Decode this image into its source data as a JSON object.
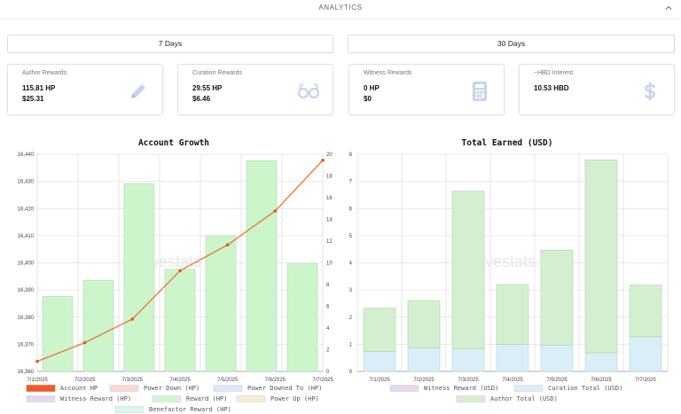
{
  "header": {
    "title": "ANALYTICS",
    "collapse_icon": "chevron-up-icon"
  },
  "periods": [
    {
      "label": "7 Days"
    },
    {
      "label": "30 Days"
    }
  ],
  "cards": [
    {
      "label": "Author Rewards",
      "value1": "115.81 HP",
      "value2": "$25.31",
      "icon": "pencil-icon"
    },
    {
      "label": "Curation Rewards",
      "value1": "29.55 HP",
      "value2": "$6.46",
      "icon": "glasses-icon"
    },
    {
      "label": "Witness Rewards",
      "value1": "0 HP",
      "value2": "$0",
      "icon": "calculator-icon"
    },
    {
      "label": "~HBD Interest",
      "value1": "10.53 HBD",
      "value2": "",
      "icon": "dollar-icon"
    }
  ],
  "colors": {
    "line": "#ee7a3e",
    "reward_bar": "#ccf5cc",
    "author_bar": "#d4efd0",
    "curation_bar": "#daeef8",
    "icon": "#c9d3ec"
  },
  "watermark": "hivestats.io",
  "chart_data": [
    {
      "type": "bar",
      "title": "Account Growth",
      "categories": [
        "7/1/2025",
        "7/2/2025",
        "7/3/2025",
        "7/4/2025",
        "7/5/2025",
        "7/6/2025",
        "7/7/2025"
      ],
      "left_axis": {
        "ylim": [
          16360,
          16440
        ],
        "ticks": [
          "16,360",
          "16,370",
          "16,380",
          "16,390",
          "16,400",
          "16,410",
          "16,420",
          "16,430",
          "16,440"
        ]
      },
      "right_axis": {
        "ylim": [
          0,
          20
        ],
        "ticks": [
          "0",
          "2",
          "4",
          "6",
          "8",
          "10",
          "12",
          "14",
          "16",
          "18",
          "20"
        ]
      },
      "series": [
        {
          "name": "Account HP",
          "kind": "line",
          "axis": "left",
          "values": [
            16363.7,
            16370.6,
            16379.3,
            16397.1,
            16406.6,
            16419.1,
            16437.8
          ]
        },
        {
          "name": "Reward (HP)",
          "kind": "bar",
          "axis": "right",
          "values": [
            6.9,
            8.4,
            17.3,
            9.4,
            12.5,
            19.4,
            9.9
          ]
        }
      ],
      "legend": [
        "Account HP",
        "Power Down (HP)",
        "Power Downed To (HP)",
        "Witness Reward (HP)",
        "Reward (HP)",
        "Power Up (HP)",
        "Benefactor Reward (HP)"
      ],
      "legend_colors": [
        "#f05a28",
        "#ffd6d6",
        "#dbe6fb",
        "#e6d8ee",
        "#d3f5d3",
        "#f8ecd0",
        "#dff5ec"
      ],
      "legend_placement": "bottom",
      "grid": true
    },
    {
      "type": "bar",
      "title": "Total Earned (USD)",
      "categories": [
        "7/1/2025",
        "7/2/2025",
        "7/3/2025",
        "7/4/2025",
        "7/5/2025",
        "7/6/2025",
        "7/7/2025"
      ],
      "ylim": [
        0,
        8
      ],
      "ticks": [
        "0",
        "1",
        "2",
        "3",
        "4",
        "5",
        "6",
        "7",
        "8"
      ],
      "stacked": true,
      "series": [
        {
          "name": "Witness Reward (USD)",
          "values": [
            0,
            0,
            0,
            0,
            0,
            0,
            0
          ]
        },
        {
          "name": "Curation Total (USD)",
          "values": [
            0.73,
            0.87,
            0.84,
            1.0,
            0.97,
            0.69,
            1.28
          ]
        },
        {
          "name": "Author Total (USD)",
          "values": [
            1.6,
            1.74,
            5.8,
            2.2,
            3.5,
            7.1,
            1.9
          ]
        }
      ],
      "legend": [
        "Witness Reward (USD)",
        "Curation Total (USD)",
        "Author Total (USD)"
      ],
      "legend_colors": [
        "#e6d8ee",
        "#dbeef9",
        "#d4efd0"
      ],
      "legend_placement": "bottom",
      "grid": true
    }
  ]
}
